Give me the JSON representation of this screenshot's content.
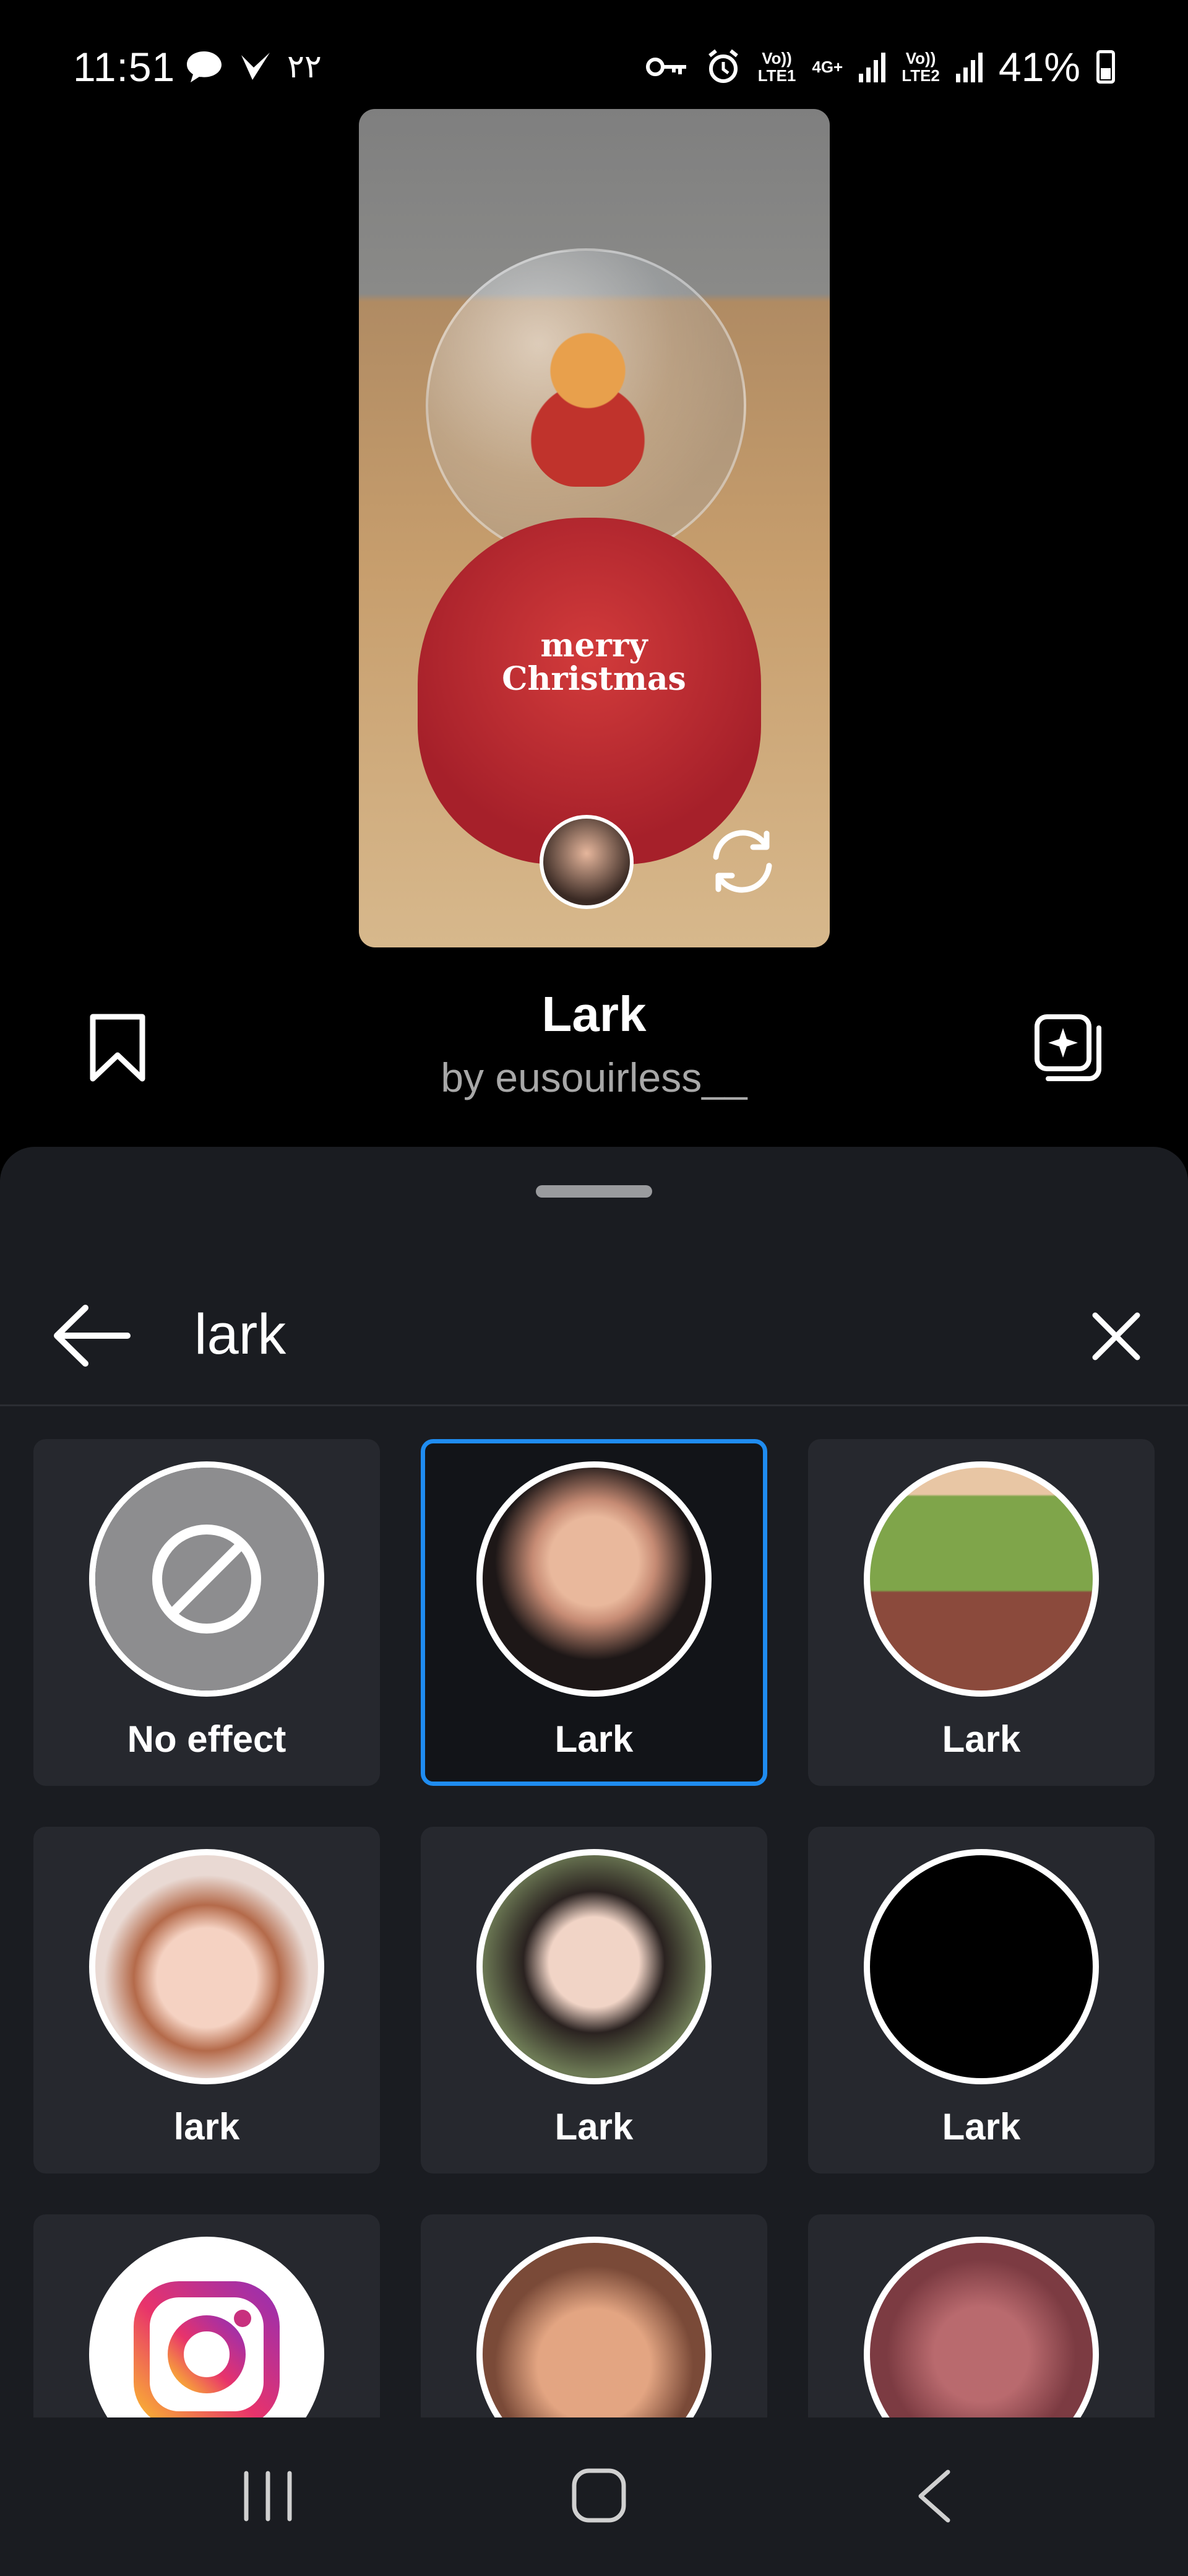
{
  "status_bar": {
    "time": "11:51",
    "extra_glyphs": "٢٢",
    "sim1_label": "Vo))\nLTE1",
    "net_label": "4G+",
    "sim2_label": "Vo))\nLTE2",
    "battery_percent": "41%"
  },
  "effect": {
    "name": "Lark",
    "author": "by eusouirless__"
  },
  "preview": {
    "decoration_text": "merry\nChristmas"
  },
  "search": {
    "query": "lark"
  },
  "results": [
    {
      "label": "No effect",
      "kind": "none",
      "selected": false
    },
    {
      "label": "Lark",
      "kind": "face",
      "selected": true
    },
    {
      "label": "Lark",
      "kind": "landscape",
      "selected": false
    },
    {
      "label": "lark",
      "kind": "face",
      "selected": false
    },
    {
      "label": "Lark",
      "kind": "face",
      "selected": false
    },
    {
      "label": "Lark",
      "kind": "black",
      "selected": false
    },
    {
      "label": "",
      "kind": "instagram-logo",
      "selected": false
    },
    {
      "label": "",
      "kind": "face",
      "selected": false
    },
    {
      "label": "",
      "kind": "flowers",
      "selected": false
    }
  ],
  "colors": {
    "sheet_bg": "#1a1c21",
    "tile_bg": "#26282e",
    "selection": "#1f8cf0"
  }
}
